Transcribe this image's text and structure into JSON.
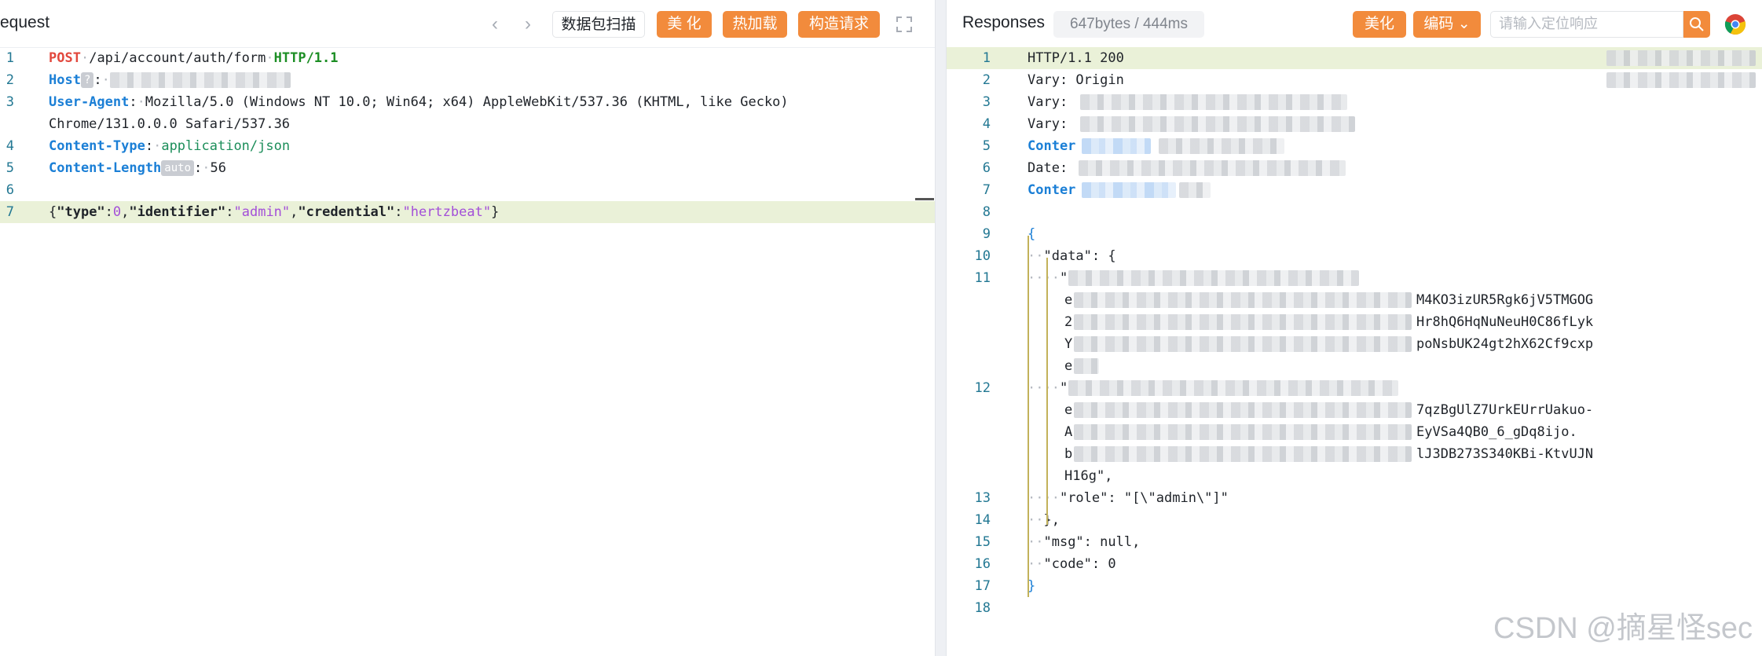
{
  "request": {
    "title": "equest",
    "toolbar": {
      "back_icon": "chevron-left-icon",
      "forward_icon": "chevron-right-icon",
      "scan_label": "数据包扫描",
      "beautify_label": "美 化",
      "hot_reload_label": "热加载",
      "construct_label": "构造请求",
      "fullscreen_icon": "expand-icon"
    },
    "lines": [
      {
        "n": "1",
        "method": "POST",
        "path": "/api/account/auth/form",
        "proto": "HTTP/1.1"
      },
      {
        "n": "2",
        "key": "Host",
        "badge": "?"
      },
      {
        "n": "3",
        "key": "User-Agent",
        "value": "Mozilla/5.0 (Windows NT 10.0; Win64; x64) AppleWebKit/537.36 (KHTML, like Gecko)",
        "cont": "Chrome/131.0.0.0 Safari/537.36"
      },
      {
        "n": "4",
        "key": "Content-Type",
        "value": "application/json"
      },
      {
        "n": "5",
        "key": "Content-Length",
        "badge": "auto",
        "value": "56"
      },
      {
        "n": "6"
      },
      {
        "n": "7",
        "body": {
          "k1": "\"type\"",
          "v1": "0",
          "k2": "\"identifier\"",
          "v2": "\"admin\"",
          "k3": "\"credential\"",
          "v3": "\"hertzbeat\""
        }
      }
    ]
  },
  "response": {
    "title": "Responses",
    "size_label": "647bytes / 444ms",
    "toolbar": {
      "beautify_label": "美化",
      "encode_label": "编码",
      "search_placeholder": "请输入定位响应",
      "search_icon": "search-icon",
      "browser_icon": "chrome-icon"
    },
    "lines": [
      {
        "n": "1",
        "text": "HTTP/1.1 200"
      },
      {
        "n": "2",
        "text": "Vary: Origin"
      },
      {
        "n": "3",
        "text": "Vary:"
      },
      {
        "n": "4",
        "text": "Vary:"
      },
      {
        "n": "5",
        "text": "Conter"
      },
      {
        "n": "6",
        "text": "Date:"
      },
      {
        "n": "7",
        "text": "Conter"
      },
      {
        "n": "8",
        "text": ""
      },
      {
        "n": "9",
        "text": "{"
      },
      {
        "n": "10",
        "text": "\"data\": {"
      },
      {
        "n": "11",
        "text": "\"",
        "wraps": [
          {
            "text": "e",
            "tail": "M4KO3izUR5Rgk6jV5TMGOG"
          },
          {
            "text": "2",
            "tail": "Hr8hQ6HqNuNeuH0C86fLyk"
          },
          {
            "text": "Y",
            "tail": "poNsbUK24gt2hX62Cf9cxp"
          },
          {
            "text": "e",
            "tail": ""
          }
        ]
      },
      {
        "n": "12",
        "text": "\"",
        "wraps": [
          {
            "text": "e",
            "tail": "7qzBgUlZ7UrkEUrrUakuo-"
          },
          {
            "text": "A",
            "tail": "EyVSa4QB0_6_gDq8ijo."
          },
          {
            "text": "b",
            "tail": "lJ3DB273S340KBi-KtvUJN"
          },
          {
            "text": "H16g\",",
            "tail": ""
          }
        ]
      },
      {
        "n": "13",
        "text": "\"role\": \"[\\\"admin\\\"]\""
      },
      {
        "n": "14",
        "text": "},"
      },
      {
        "n": "15",
        "text": "\"msg\": null,"
      },
      {
        "n": "16",
        "text": "\"code\": 0"
      },
      {
        "n": "17",
        "text": "}"
      },
      {
        "n": "18",
        "text": ""
      }
    ]
  },
  "watermark": "CSDN @摘星怪sec",
  "colors": {
    "accent": "#f28b3c",
    "header_key": "#1b7fd6",
    "method": "#e2483d",
    "protocol": "#1c8e24",
    "string": "#a34fd8",
    "line_number": "#237893",
    "highlight": "#eaf1d8"
  }
}
